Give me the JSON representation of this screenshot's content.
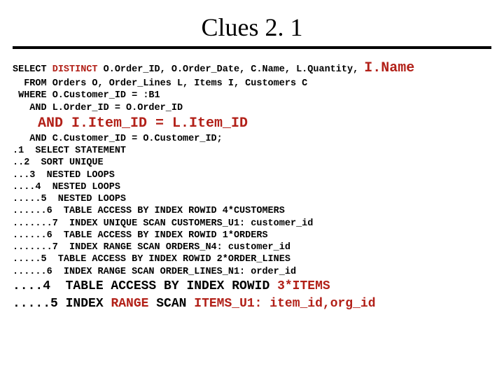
{
  "title": "Clues 2. 1",
  "sql": {
    "l1a": "SELECT ",
    "l1b": "DISTINCT",
    "l1c": " O.Order_ID, O.Order_Date, C.Name, L.Quantity, ",
    "l1d": "I.Name",
    "l2": "  FROM Orders O, Order_Lines L, Items I, Customers C",
    "l3": " WHERE O.Customer_ID = :B1",
    "l4": "   AND L.Order_ID = O.Order_ID",
    "l5": "   AND I.Item_ID = L.Item_ID"
  },
  "plan": {
    "p0": "   AND C.Customer_ID = O.Customer_ID;",
    "p1": ".1  SELECT STATEMENT",
    "p2": "..2  SORT UNIQUE",
    "p3": "...3  NESTED LOOPS",
    "p4": "....4  NESTED LOOPS",
    "p5": ".....5  NESTED LOOPS",
    "p6": "......6  TABLE ACCESS BY INDEX ROWID 4*CUSTOMERS",
    "p7": ".......7  INDEX UNIQUE SCAN CUSTOMERS_U1: customer_id",
    "p8": "......6  TABLE ACCESS BY INDEX ROWID 1*ORDERS",
    "p9": ".......7  INDEX RANGE SCAN ORDERS_N4: customer_id",
    "p10": ".....5  TABLE ACCESS BY INDEX ROWID 2*ORDER_LINES",
    "p11": "......6  INDEX RANGE SCAN ORDER_LINES_N1: order_id"
  },
  "highlight": {
    "h1a": "....4  TABLE ACCESS BY INDEX ROWID ",
    "h1b": "3*ITEMS",
    "h2a": ".....5 INDEX ",
    "h2b": "RANGE",
    "h2c": " SCAN ",
    "h2d": "ITEMS_U1: item_id,org_id"
  }
}
